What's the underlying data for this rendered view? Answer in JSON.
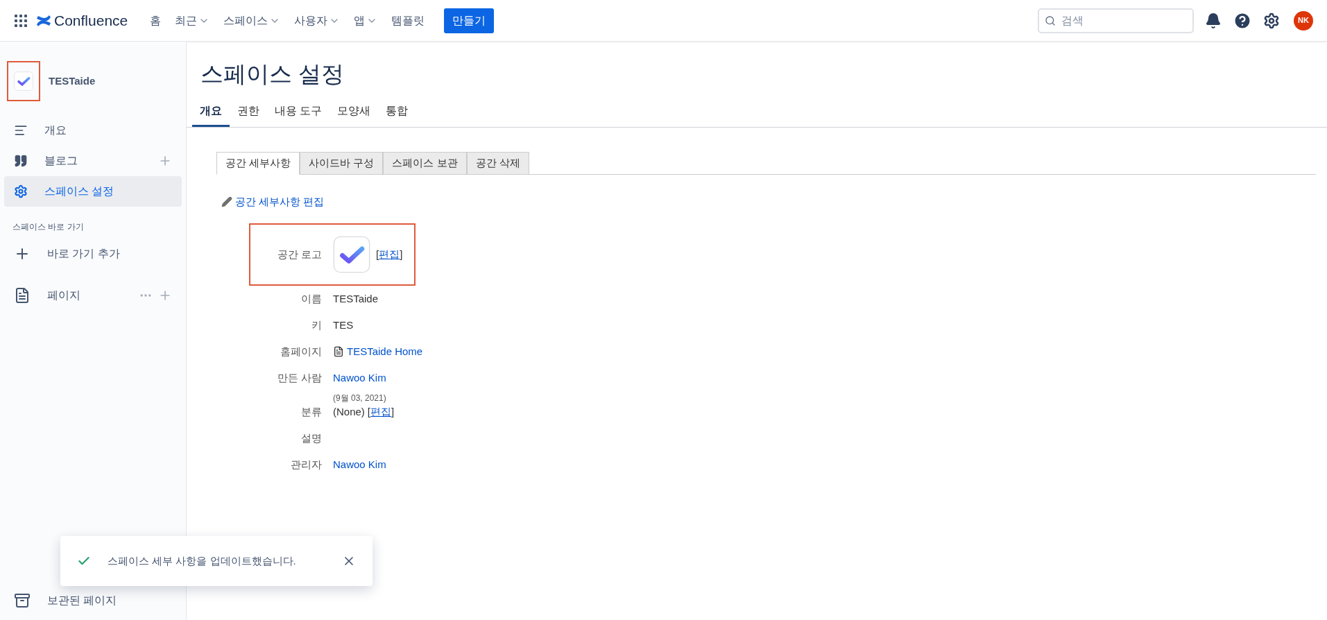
{
  "topbar": {
    "product": "Confluence",
    "nav": [
      {
        "label": "홈",
        "dropdown": false
      },
      {
        "label": "최근",
        "dropdown": true
      },
      {
        "label": "스페이스",
        "dropdown": true
      },
      {
        "label": "사용자",
        "dropdown": true
      },
      {
        "label": "앱",
        "dropdown": true
      },
      {
        "label": "템플릿",
        "dropdown": false
      }
    ],
    "create_button": "만들기",
    "search": {
      "placeholder": "검색"
    },
    "avatar": "NK"
  },
  "sidebar": {
    "space_name": "TESTaide",
    "logo_highlighted": true,
    "items": [
      {
        "label": "개요",
        "kind": "overview",
        "selected": false,
        "add": false
      },
      {
        "label": "블로그",
        "kind": "quote",
        "selected": false,
        "add": true
      },
      {
        "label": "스페이스 설정",
        "kind": "gear",
        "selected": true,
        "add": false
      }
    ],
    "shortcuts_heading": "스페이스 바로 가기",
    "add_shortcut": "바로 가기 추가",
    "pages": {
      "label": "페이지",
      "more": true,
      "add": true
    },
    "archived": "보관된 페이지"
  },
  "main": {
    "title": "스페이스 설정",
    "tabs": [
      {
        "label": "개요",
        "selected": true
      },
      {
        "label": "권한",
        "selected": false
      },
      {
        "label": "내용 도구",
        "selected": false
      },
      {
        "label": "모양새",
        "selected": false
      },
      {
        "label": "통합",
        "selected": false
      }
    ],
    "subtabs": [
      {
        "label": "공간 세부사항",
        "selected": true
      },
      {
        "label": "사이드바 구성",
        "selected": false
      },
      {
        "label": "스페이스 보관",
        "selected": false
      },
      {
        "label": "공간 삭제",
        "selected": false
      }
    ],
    "edit_link": "공간 세부사항 편집",
    "details": [
      {
        "label": "공간 로고",
        "kind": "logo",
        "highlighted": true,
        "edit": {
          "open": "[",
          "label": "편집",
          "close": "]"
        }
      },
      {
        "label": "이름",
        "kind": "text",
        "value": "TESTaide"
      },
      {
        "label": "키",
        "kind": "text",
        "value": "TES"
      },
      {
        "label": "홈페이지",
        "kind": "page",
        "value": "TESTaide Home"
      },
      {
        "label": "만든 사람",
        "kind": "link",
        "value": "Nawoo Kim",
        "note": "(9월 03, 2021)"
      },
      {
        "label": "분류",
        "kind": "text",
        "value": "(None)",
        "edit": {
          "open": "[",
          "label": "편집",
          "close": "]"
        }
      },
      {
        "label": "설명",
        "kind": "empty"
      },
      {
        "label": "관리자",
        "kind": "link",
        "value": "Nawoo Kim"
      }
    ]
  },
  "toast": {
    "message": "스페이스 세부 사항을 업데이트했습니다."
  }
}
